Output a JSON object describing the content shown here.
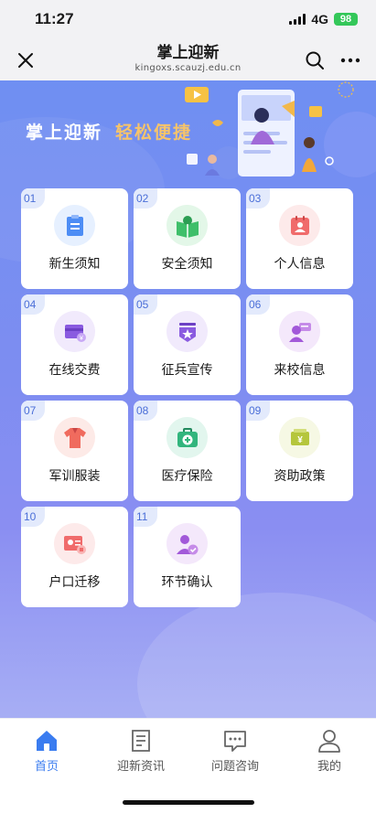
{
  "status_bar": {
    "time": "11:27",
    "network": "4G",
    "battery": "98"
  },
  "nav": {
    "title": "掌上迎新",
    "url": "kingoxs.scauzj.edu.cn"
  },
  "banner": {
    "title": "掌上迎新",
    "slogan": "轻松便捷"
  },
  "grid": {
    "items": [
      {
        "num": "01",
        "label": "新生须知",
        "icon": "clipboard-icon",
        "color": "#4d8df5"
      },
      {
        "num": "02",
        "label": "安全须知",
        "icon": "book-icon",
        "color": "#3fbf6a"
      },
      {
        "num": "03",
        "label": "个人信息",
        "icon": "id-card-icon",
        "color": "#f06b6b"
      },
      {
        "num": "04",
        "label": "在线交费",
        "icon": "payment-icon",
        "color": "#8a5be0"
      },
      {
        "num": "05",
        "label": "征兵宣传",
        "icon": "military-badge-icon",
        "color": "#8a5be0"
      },
      {
        "num": "06",
        "label": "来校信息",
        "icon": "user-chat-icon",
        "color": "#a259d9"
      },
      {
        "num": "07",
        "label": "军训服装",
        "icon": "uniform-icon",
        "color": "#f06b5e"
      },
      {
        "num": "08",
        "label": "医疗保险",
        "icon": "medical-kit-icon",
        "color": "#32b57d"
      },
      {
        "num": "09",
        "label": "资助政策",
        "icon": "money-icon",
        "color": "#b5c63c"
      },
      {
        "num": "10",
        "label": "户口迁移",
        "icon": "household-card-icon",
        "color": "#f06b6b"
      },
      {
        "num": "11",
        "label": "环节确认",
        "icon": "user-check-icon",
        "color": "#a259d9"
      }
    ]
  },
  "tabs": [
    {
      "label": "首页",
      "icon": "home-icon",
      "active": true
    },
    {
      "label": "迎新资讯",
      "icon": "news-icon",
      "active": false
    },
    {
      "label": "问题咨询",
      "icon": "chat-icon",
      "active": false
    },
    {
      "label": "我的",
      "icon": "profile-icon",
      "active": false
    }
  ],
  "colors": {
    "accent": "#3a7cf0",
    "slogan": "#f7c46a",
    "background": "#7d8df1"
  }
}
